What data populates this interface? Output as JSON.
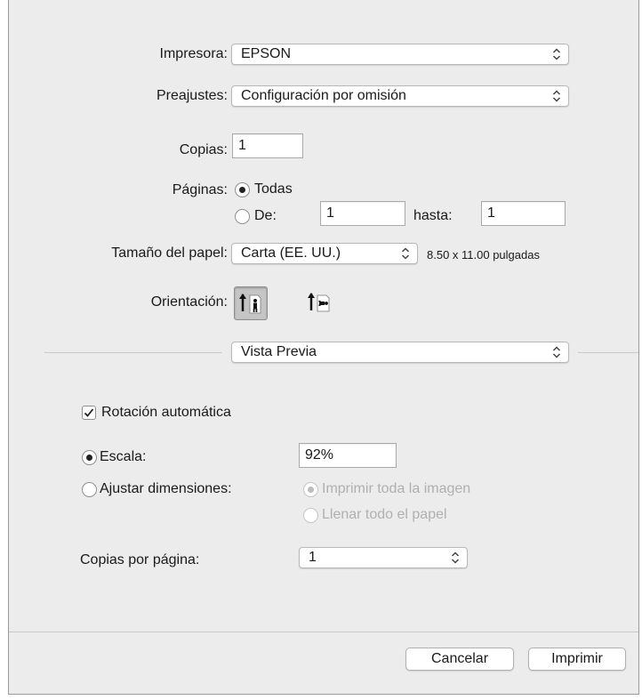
{
  "printer": {
    "label": "Impresora:",
    "value": "EPSON"
  },
  "presets": {
    "label": "Preajustes:",
    "value": "Configuración por omisión"
  },
  "copies": {
    "label": "Copias:",
    "value": "1"
  },
  "pages": {
    "label": "Páginas:",
    "all_label": "Todas",
    "from_label": "De:",
    "from_value": "1",
    "to_label": "hasta:",
    "to_value": "1"
  },
  "paper_size": {
    "label": "Tamaño del papel:",
    "value": "Carta (EE. UU.)",
    "dimensions": "8.50 x 11.00 pulgadas"
  },
  "orientation": {
    "label": "Orientación:"
  },
  "section": {
    "value": "Vista Previa"
  },
  "preview": {
    "auto_rotate_label": "Rotación automática",
    "scale_label": "Escala:",
    "scale_value": "92%",
    "fit_label": "Ajustar dimensiones:",
    "fit_whole_label": "Imprimir toda la imagen",
    "fill_paper_label": "Llenar todo el papel",
    "copies_per_page_label": "Copias por página:",
    "copies_per_page_value": "1"
  },
  "buttons": {
    "cancel": "Cancelar",
    "print": "Imprimir"
  }
}
